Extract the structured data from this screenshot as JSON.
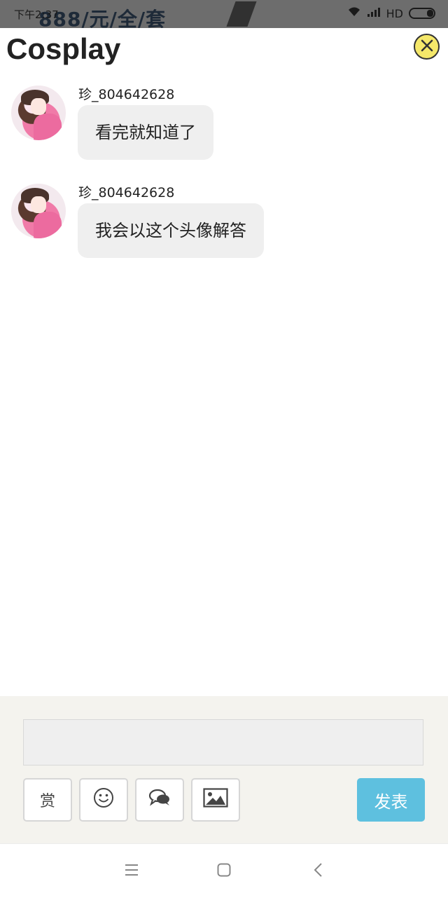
{
  "status_bar": {
    "time": "下午2:37",
    "network": "HD",
    "background_page_title": "888/元/全/套"
  },
  "sheet": {
    "title": "Cosplay",
    "close_icon": "close-circle-icon"
  },
  "messages": [
    {
      "username": "珍_804642628",
      "text": "看完就知道了"
    },
    {
      "username": "珍_804642628",
      "text": "我会以这个头像解答"
    }
  ],
  "composer": {
    "input_value": "",
    "reward_label": "赏",
    "emoji_icon": "smiley-icon",
    "chat_icon": "chat-bubbles-icon",
    "image_icon": "image-icon",
    "post_label": "发表"
  },
  "nav": {
    "menu_icon": "menu-icon",
    "home_icon": "home-square-icon",
    "back_icon": "back-chevron-icon"
  },
  "colors": {
    "close_button": "#f5e86a",
    "bubble": "#efefef",
    "post_button": "#5ec0df",
    "composer_bg": "#f4f3ee"
  }
}
